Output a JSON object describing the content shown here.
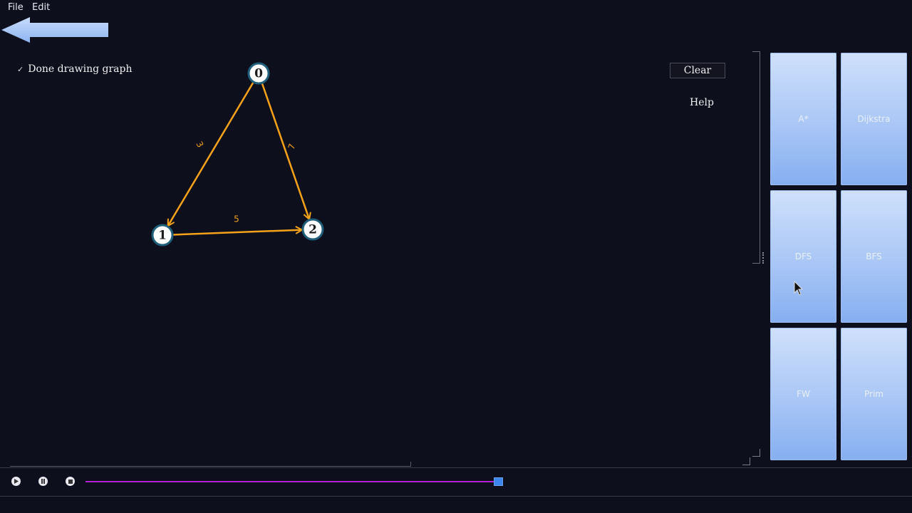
{
  "menu": {
    "file": "File",
    "edit": "Edit"
  },
  "controls": {
    "done_drawing_label": "Done drawing graph",
    "done_drawing_checked": true,
    "clear_label": "Clear",
    "help_label": "Help"
  },
  "graph": {
    "nodes": [
      {
        "id": "0",
        "label": "0"
      },
      {
        "id": "1",
        "label": "1"
      },
      {
        "id": "2",
        "label": "2"
      }
    ],
    "edges": [
      {
        "from": "0",
        "to": "1",
        "weight": "3"
      },
      {
        "from": "0",
        "to": "2",
        "weight": "7"
      },
      {
        "from": "1",
        "to": "2",
        "weight": "5"
      }
    ],
    "edge_color": "#f5a21a",
    "node_fill": "#ffffff",
    "node_stroke": "#1f5f7a"
  },
  "algorithms": [
    "A*",
    "Dijkstra",
    "DFS",
    "BFS",
    "FW",
    "Prim"
  ],
  "player": {
    "play_icon": "play-icon",
    "pause_icon": "pause-icon",
    "stop_icon": "stop-icon",
    "progress": 1.0,
    "track_color": "#b020d8",
    "handle_color": "#3d86f0"
  }
}
